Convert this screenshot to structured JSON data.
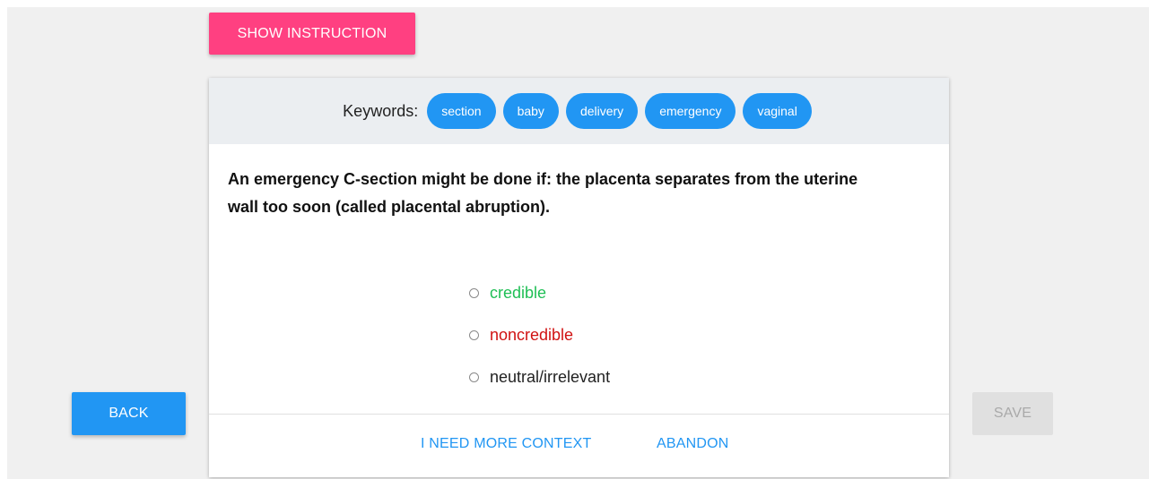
{
  "header": {
    "show_instruction_label": "SHOW INSTRUCTION"
  },
  "keywords": {
    "label": "Keywords:",
    "items": [
      "section",
      "baby",
      "delivery",
      "emergency",
      "vaginal"
    ]
  },
  "statement": "An emergency C-section might be done if: the placenta separates from the uterine wall too soon (called placental abruption).",
  "options": [
    {
      "label": "credible",
      "color": "#1fbf55",
      "selected": false
    },
    {
      "label": "noncredible",
      "color": "#d01212",
      "selected": false
    },
    {
      "label": "neutral/irrelevant",
      "color": "#222222",
      "selected": false
    }
  ],
  "footer": {
    "need_context_label": "I NEED MORE CONTEXT",
    "abandon_label": "ABANDON"
  },
  "nav": {
    "back_label": "BACK",
    "save_label": "SAVE",
    "save_enabled": false
  },
  "colors": {
    "accent_pink": "#ff4081",
    "primary_blue": "#2196f3",
    "disabled_gray": "#e0e0e0"
  }
}
